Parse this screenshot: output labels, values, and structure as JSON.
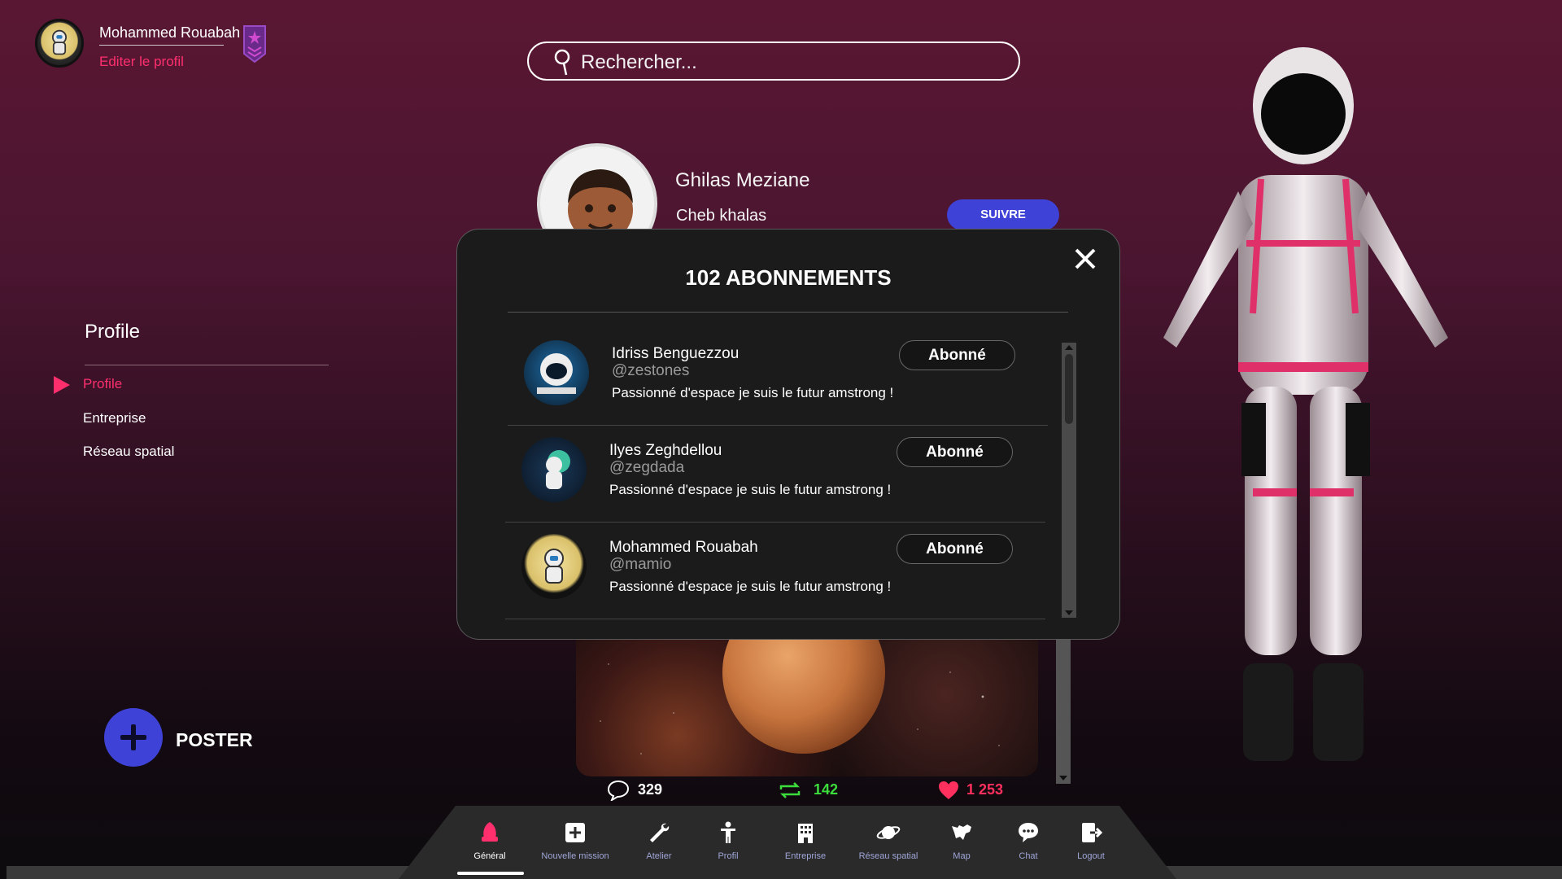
{
  "user": {
    "name": "Mohammed Rouabah",
    "edit_label": "Editer le profil"
  },
  "search": {
    "placeholder": "Rechercher..."
  },
  "profile": {
    "name": "Ghilas Meziane",
    "subtitle": "Cheb khalas",
    "follow_label": "SUIVRE"
  },
  "sidebar": {
    "title": "Profile",
    "items": [
      {
        "label": "Profile",
        "active": true
      },
      {
        "label": "Entreprise",
        "active": false
      },
      {
        "label": "Réseau spatial",
        "active": false
      }
    ]
  },
  "poster": {
    "label": "POSTER"
  },
  "post_stats": {
    "comments": "329",
    "reposts": "142",
    "likes": "1 253"
  },
  "modal": {
    "title": "102 ABONNEMENTS",
    "entries": [
      {
        "name": "Idriss Benguezzou",
        "handle": "@zestones",
        "bio": "Passionné d'espace je suis le futur amstrong !",
        "button": "Abonné",
        "avatar": "astronaut-helmet-avatar"
      },
      {
        "name": "Ilyes Zeghdellou",
        "handle": "@zegdada",
        "bio": "Passionné d'espace je suis le futur amstrong !",
        "button": "Abonné",
        "avatar": "astronaut-moon-avatar"
      },
      {
        "name": "Mohammed Rouabah",
        "handle": "@mamio",
        "bio": "Passionné d'espace je suis le futur amstrong !",
        "button": "Abonné",
        "avatar": "astronaut-yellow-avatar"
      }
    ]
  },
  "nav": [
    {
      "label": "Général",
      "icon": "rocket-icon",
      "active": true
    },
    {
      "label": "Nouvelle mission",
      "icon": "plus-square-icon",
      "active": false
    },
    {
      "label": "Atelier",
      "icon": "wrench-icon",
      "active": false
    },
    {
      "label": "Profil",
      "icon": "person-icon",
      "active": false
    },
    {
      "label": "Entreprise",
      "icon": "building-icon",
      "active": false
    },
    {
      "label": "Réseau spatial",
      "icon": "planet-icon",
      "active": false
    },
    {
      "label": "Map",
      "icon": "map-icon",
      "active": false
    },
    {
      "label": "Chat",
      "icon": "chat-icon",
      "active": false
    },
    {
      "label": "Logout",
      "icon": "logout-icon",
      "active": false
    }
  ],
  "colors": {
    "accent_pink": "#ff2f6e",
    "accent_blue": "#3f42d6",
    "repost_green": "#3ddc3d",
    "like_red": "#ff2f5e"
  }
}
